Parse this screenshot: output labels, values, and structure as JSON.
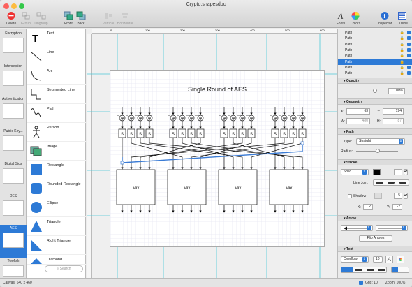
{
  "window": {
    "title": "Crypto.shapesdoc"
  },
  "toolbar": {
    "left": [
      {
        "label": "Delete",
        "icon": "delete-icon"
      },
      {
        "label": "Group",
        "icon": "group-icon"
      },
      {
        "label": "Ungroup",
        "icon": "ungroup-icon"
      },
      {
        "label": "Front",
        "icon": "bring-front-icon"
      },
      {
        "label": "Back",
        "icon": "send-back-icon"
      },
      {
        "label": "Vertical",
        "icon": "align-vertical-icon"
      },
      {
        "label": "Horizontal",
        "icon": "align-horizontal-icon"
      }
    ],
    "right": [
      {
        "label": "Fonts",
        "icon": "fonts-icon"
      },
      {
        "label": "Colors",
        "icon": "colors-icon"
      },
      {
        "label": "Inspector",
        "icon": "inspector-icon"
      },
      {
        "label": "Outline",
        "icon": "outline-icon"
      }
    ]
  },
  "sections": [
    "Encryption",
    "Interception",
    "Authentication",
    "Public Key...",
    "Digital Sigs",
    "DES",
    "AES",
    "Twofish"
  ],
  "selected_section": "AES",
  "shapes": [
    "Text",
    "Line",
    "Arc",
    "Segmented Line",
    "Path",
    "Person",
    "Image",
    "Rectangle",
    "Rounded Rectangle",
    "Ellipse",
    "Triangle",
    "Right Triangle",
    "Diamond"
  ],
  "search": {
    "placeholder": "Search"
  },
  "canvas": {
    "title": "Single Round of AES",
    "sbox_label": "S",
    "mix_label": "Mix",
    "xor_symbol": "⊕",
    "ruler_marks": [
      "0",
      "100",
      "200",
      "300",
      "400",
      "500",
      "600"
    ]
  },
  "statusbar": {
    "canvas": "Canvas: 640 x 460",
    "grid": "Grid: 10",
    "zoom": "Zoom: 100%"
  },
  "inspector": {
    "layers": [
      "Path",
      "Path",
      "Path",
      "Path",
      "Path",
      "Path",
      "Path",
      "Path"
    ],
    "selected_layer": 5,
    "opacity": {
      "title": "Opacity",
      "value": "100%"
    },
    "geometry": {
      "title": "Geometry",
      "x_label": "X:",
      "x": "63",
      "y_label": "Y:",
      "y": "194",
      "w_label": "W:",
      "w": "480",
      "h_label": "H:",
      "h": "87"
    },
    "path": {
      "title": "Path",
      "type_label": "Type:",
      "type": "Straight",
      "radius_label": "Radius:"
    },
    "stroke": {
      "title": "Stroke",
      "style": "Solid",
      "width": "1",
      "line_join_label": "Line Join:",
      "shadow_label": "Shadow",
      "shadow_blur": "5",
      "shadow_x": "2",
      "shadow_y": "-2",
      "x_label": "X:",
      "y_label": "Y:"
    },
    "arrow": {
      "title": "Arrow",
      "flip_label": "Flip Arrows"
    },
    "text": {
      "title": "Text",
      "overflow": "Overflow",
      "size": "10"
    }
  },
  "colors": {
    "accent": "#2d7ad6",
    "guide": "#4cc9d9"
  }
}
